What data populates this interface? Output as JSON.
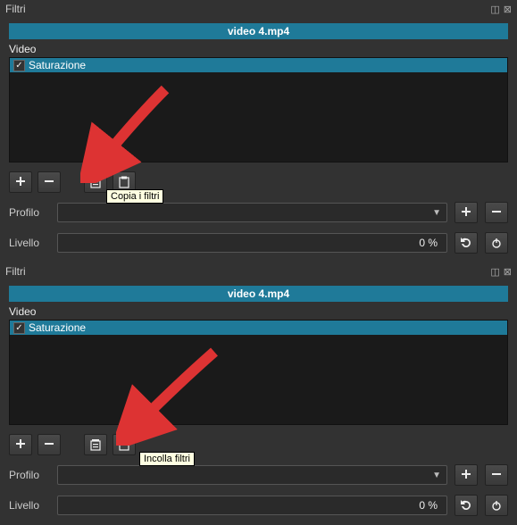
{
  "panels": [
    {
      "title": "Filtri",
      "clip_name": "video 4.mp4",
      "group_label": "Video",
      "filter_name": "Saturazione",
      "tooltip": "Copia i filtri",
      "profile_label": "Profilo",
      "level_label": "Livello",
      "level_value": "0 %"
    },
    {
      "title": "Filtri",
      "clip_name": "video 4.mp4",
      "group_label": "Video",
      "filter_name": "Saturazione",
      "tooltip": "Incolla filtri",
      "profile_label": "Profilo",
      "level_label": "Livello",
      "level_value": "0 %"
    }
  ]
}
